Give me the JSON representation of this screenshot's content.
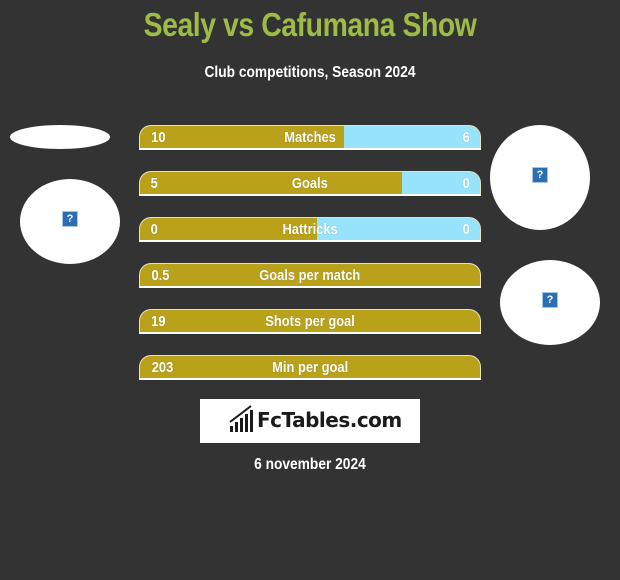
{
  "header": {
    "title": "Sealy vs Cafumana Show",
    "subtitle": "Club competitions, Season 2024"
  },
  "colors": {
    "title": "#9dbb45",
    "left_bar": "#b9a21a",
    "right_bar": "#97e3fb",
    "background": "#333333"
  },
  "stats": [
    {
      "label": "Matches",
      "left": "10",
      "right": "6",
      "right_share": 0.4
    },
    {
      "label": "Goals",
      "left": "5",
      "right": "0",
      "right_share": 0.23
    },
    {
      "label": "Hattricks",
      "left": "0",
      "right": "0",
      "right_share": 0.48
    },
    {
      "label": "Goals per match",
      "left": "0.5",
      "right": "",
      "right_share": 0
    },
    {
      "label": "Shots per goal",
      "left": "19",
      "right": "",
      "right_share": 0
    },
    {
      "label": "Min per goal",
      "left": "203",
      "right": "",
      "right_share": 0
    }
  ],
  "images": {
    "placeholder_icon": "?",
    "left_team_logo": "broken-image-icon",
    "right_team_logo": "broken-image-icon",
    "right_player_photo": "broken-image-icon"
  },
  "footer": {
    "brand": "FcTables.com",
    "date": "6 november 2024"
  }
}
